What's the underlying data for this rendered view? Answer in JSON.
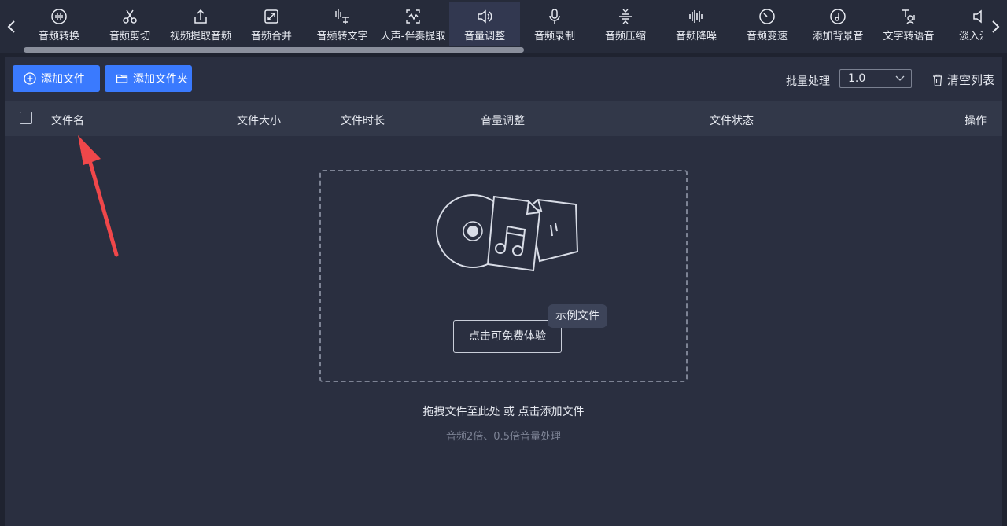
{
  "toolbar": {
    "tools": [
      {
        "label": "音频转换",
        "icon": "audio-wave-icon"
      },
      {
        "label": "音频剪切",
        "icon": "scissors-icon"
      },
      {
        "label": "视频提取音频",
        "icon": "upload-icon"
      },
      {
        "label": "音频合并",
        "icon": "merge-icon"
      },
      {
        "label": "音频转文字",
        "icon": "speech-to-text-icon"
      },
      {
        "label": "人声-伴奏提取",
        "icon": "vocal-extract-icon"
      },
      {
        "label": "音量调整",
        "icon": "speaker-icon",
        "active": true
      },
      {
        "label": "音频录制",
        "icon": "microphone-icon"
      },
      {
        "label": "音频压缩",
        "icon": "compress-icon"
      },
      {
        "label": "音频降噪",
        "icon": "equalizer-icon"
      },
      {
        "label": "音频变速",
        "icon": "speedometer-icon"
      },
      {
        "label": "添加背景音",
        "icon": "music-disc-icon"
      },
      {
        "label": "文字转语音",
        "icon": "text-to-speech-icon"
      },
      {
        "label": "淡入淡出",
        "icon": "fade-icon"
      }
    ]
  },
  "actions": {
    "add_file": "添加文件",
    "add_folder": "添加文件夹",
    "batch_label": "批量处理",
    "batch_value": "1.0",
    "clear_list": "清空列表"
  },
  "table": {
    "columns": [
      "文件名",
      "文件大小",
      "文件时长",
      "音量调整",
      "文件状态",
      "操作"
    ]
  },
  "dropzone": {
    "try_button": "点击可免费体验",
    "sample_tag": "示例文件",
    "hint": "拖拽文件至此处 或 点击添加文件",
    "sub_hint": "音频2倍、0.5倍音量处理"
  },
  "colors": {
    "accent": "#3a7afe",
    "background": "#1f2330",
    "panel": "#2a2f40",
    "annotation_arrow": "#f0474a"
  }
}
